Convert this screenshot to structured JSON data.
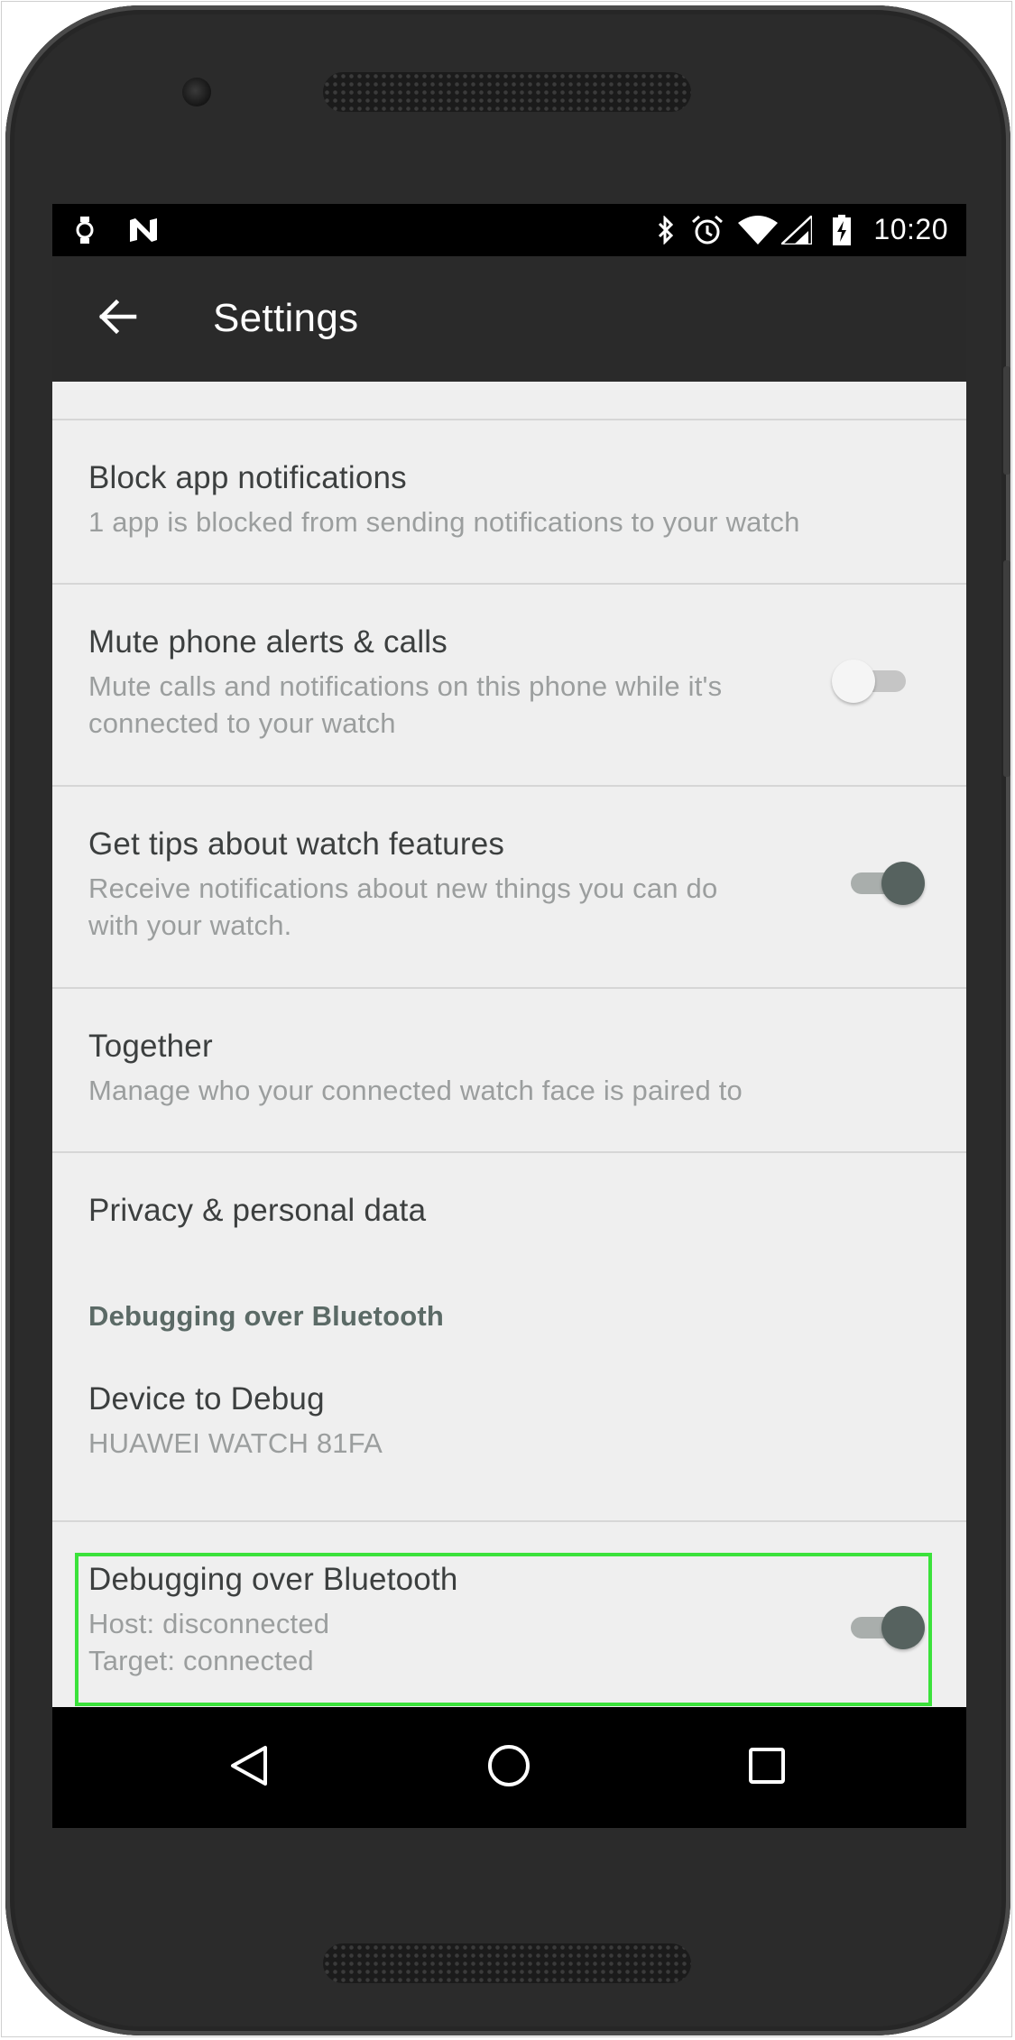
{
  "status_bar": {
    "time": "10:20",
    "left_icons": [
      "watch-icon",
      "n-logo-icon"
    ],
    "right_icons": [
      "bluetooth-icon",
      "alarm-icon",
      "wifi-icon",
      "signal-icon",
      "battery-charging-icon"
    ]
  },
  "app_bar": {
    "title": "Settings",
    "back_icon": "arrow-left-icon"
  },
  "settings": [
    {
      "title": "Block app notifications",
      "summary_lines": [
        "1 app is blocked from sending notifications to your watch"
      ]
    },
    {
      "title": "Mute phone alerts & calls",
      "summary_lines": [
        "Mute calls and notifications on this phone while it's",
        "connected to your watch"
      ],
      "toggle": "off"
    },
    {
      "title": "Get tips about watch features",
      "summary_lines": [
        "Receive notifications about new things you can do",
        "with your watch."
      ],
      "toggle": "on"
    },
    {
      "title": "Together",
      "summary_lines": [
        "Manage who your connected watch face is paired to"
      ]
    },
    {
      "title": "Privacy & personal data"
    }
  ],
  "debug_section": {
    "header": "Debugging over Bluetooth",
    "device": {
      "title": "Device to Debug",
      "summary": "HUAWEI WATCH 81FA"
    },
    "debugging": {
      "title": "Debugging over Bluetooth",
      "summary_lines": [
        "Host: disconnected",
        "Target: connected"
      ],
      "toggle": "on"
    }
  },
  "nav_bar": {
    "icons": [
      "back-triangle-icon",
      "home-circle-icon",
      "recents-square-icon"
    ]
  },
  "colors": {
    "highlight": "#3be23b",
    "toggle_on_thumb": "#56625f",
    "background": "#efefef"
  }
}
